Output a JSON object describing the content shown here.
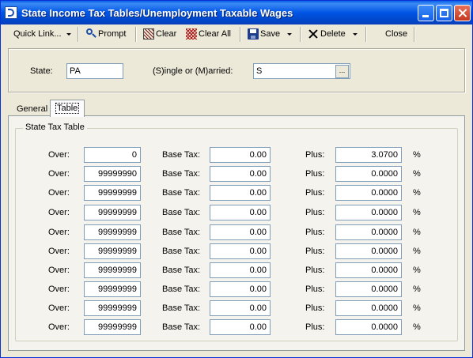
{
  "window": {
    "title": "State Income Tax Tables/Unemployment Taxable Wages"
  },
  "toolbar": {
    "quick_link": "Quick Link...",
    "prompt": "Prompt",
    "clear": "Clear",
    "clear_all": "Clear All",
    "save": "Save",
    "delete": "Delete",
    "close": "Close"
  },
  "filters": {
    "state_label": "State:",
    "state_value": "PA",
    "status_label": "(S)ingle or (M)arried:",
    "status_value": "S",
    "browse_label": "..."
  },
  "tabs": {
    "general": "General",
    "table": "Table"
  },
  "tax_table": {
    "title": "State Tax Table",
    "over_label": "Over:",
    "base_tax_label": "Base Tax:",
    "plus_label": "Plus:",
    "percent_symbol": "%",
    "rows": [
      {
        "over": "0",
        "base_tax": "0.00",
        "plus": "3.0700"
      },
      {
        "over": "99999990",
        "base_tax": "0.00",
        "plus": "0.0000"
      },
      {
        "over": "99999999",
        "base_tax": "0.00",
        "plus": "0.0000"
      },
      {
        "over": "99999999",
        "base_tax": "0.00",
        "plus": "0.0000"
      },
      {
        "over": "99999999",
        "base_tax": "0.00",
        "plus": "0.0000"
      },
      {
        "over": "99999999",
        "base_tax": "0.00",
        "plus": "0.0000"
      },
      {
        "over": "99999999",
        "base_tax": "0.00",
        "plus": "0.0000"
      },
      {
        "over": "99999999",
        "base_tax": "0.00",
        "plus": "0.0000"
      },
      {
        "over": "99999999",
        "base_tax": "0.00",
        "plus": "0.0000"
      },
      {
        "over": "99999999",
        "base_tax": "0.00",
        "plus": "0.0000"
      }
    ]
  }
}
